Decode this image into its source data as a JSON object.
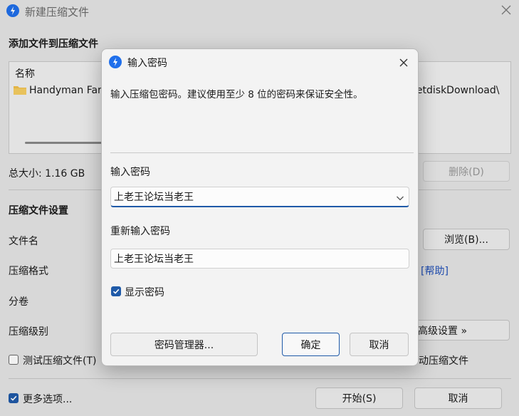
{
  "main_window": {
    "title": "新建压缩文件",
    "section_add_title": "添加文件到压缩文件",
    "list": {
      "column_name": "名称",
      "item_name": "Handyman Far",
      "right_path": "letdiskDownload\\"
    },
    "total_size": "总大小: 1.16 GB",
    "delete_button": "删除(D)",
    "settings_title": "压缩文件设置",
    "labels": {
      "file_name": "文件名",
      "format": "压缩格式",
      "volume": "分卷",
      "level": "压缩级别"
    },
    "browse_button": "浏览(B)...",
    "help_link": "[帮助]",
    "advanced_button": "高级设置 »",
    "test_checkbox_label": "测试压缩文件(T)",
    "right_checkbox_label": "动压缩文件",
    "more_options_label": "更多选项...",
    "start_button": "开始(S)",
    "cancel_button": "取消"
  },
  "dialog": {
    "title": "输入密码",
    "description": "输入压缩包密码。建议使用至少 8 位的密码来保证安全性。",
    "password_label": "输入密码",
    "password_value": "上老王论坛当老王",
    "reenter_label": "重新输入密码",
    "reenter_value": "上老王论坛当老王",
    "show_password_label": "显示密码",
    "show_password_checked": true,
    "manager_button": "密码管理器...",
    "ok_button": "确定",
    "cancel_button": "取消"
  },
  "colors": {
    "accent": "#1f5aa8",
    "link": "#1f4fb8"
  }
}
